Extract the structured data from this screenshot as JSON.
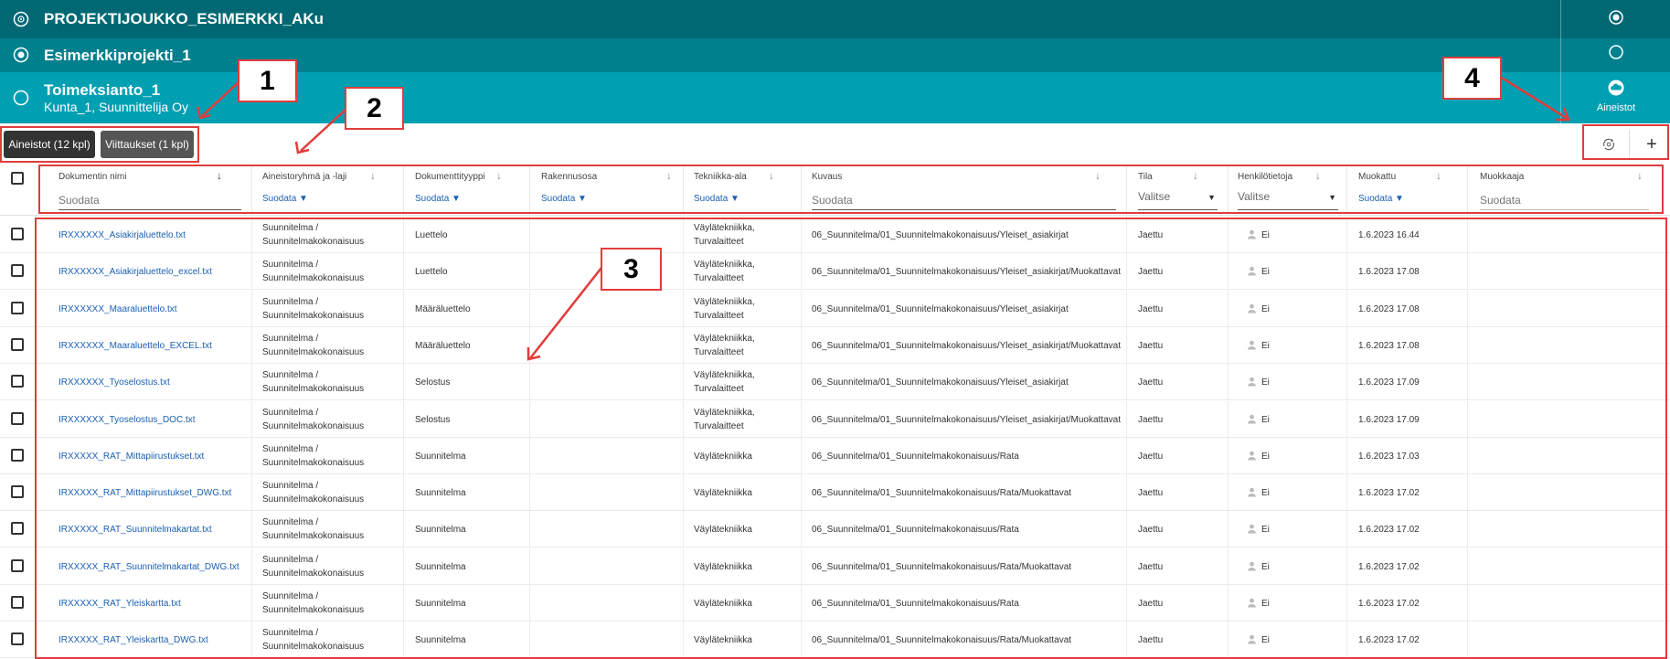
{
  "header": {
    "group_title": "PROJEKTIJOUKKO_ESIMERKKI_AKu",
    "project_title": "Esimerkkiprojekti_1",
    "assignment_title": "Toimeksianto_1",
    "assignment_subtitle": "Kunta_1, Suunnittelija Oy",
    "aineistot_label": "Aineistot"
  },
  "toolbar": {
    "tab_materials": "Aineistot (12 kpl)",
    "tab_references": "Viittaukset (1 kpl)",
    "add_label": "+"
  },
  "table": {
    "columns": [
      {
        "label": "Dokumentin nimi",
        "filter": "Suodata",
        "filter_type": "input"
      },
      {
        "label": "Aineistoryhmä ja -laji",
        "filter": "Suodata",
        "filter_type": "link"
      },
      {
        "label": "Dokumenttityyppi",
        "filter": "Suodata",
        "filter_type": "link"
      },
      {
        "label": "Rakennusosa",
        "filter": "Suodata",
        "filter_type": "link"
      },
      {
        "label": "Tekniikka-ala",
        "filter": "Suodata",
        "filter_type": "link"
      },
      {
        "label": "Kuvaus",
        "filter": "Suodata",
        "filter_type": "input"
      },
      {
        "label": "Tila",
        "filter": "Valitse",
        "filter_type": "select"
      },
      {
        "label": "Henkilötietoja",
        "filter": "Valitse",
        "filter_type": "select"
      },
      {
        "label": "Muokattu",
        "filter": "Suodata",
        "filter_type": "link"
      },
      {
        "label": "Muokkaaja",
        "filter": "Suodata",
        "filter_type": "input"
      }
    ],
    "rows": [
      {
        "name": "IRXXXXXX_Asiakirjaluettelo.txt",
        "group1": "Suunnitelma /",
        "group2": "Suunnitelmakokonaisuus",
        "type": "Luettelo",
        "tech1": "Väylätekniikka,",
        "tech2": "Turvalaitteet",
        "desc": "06_Suunnitelma/01_Suunnitelmakokonaisuus/Yleiset_asiakirjat",
        "status": "Jaettu",
        "personal": "Ei",
        "modified": "1.6.2023 16.44"
      },
      {
        "name": "IRXXXXXX_Asiakirjaluettelo_excel.txt",
        "group1": "Suunnitelma /",
        "group2": "Suunnitelmakokonaisuus",
        "type": "Luettelo",
        "tech1": "Väylätekniikka,",
        "tech2": "Turvalaitteet",
        "desc": "06_Suunnitelma/01_Suunnitelmakokonaisuus/Yleiset_asiakirjat/Muokattavat",
        "status": "Jaettu",
        "personal": "Ei",
        "modified": "1.6.2023 17.08"
      },
      {
        "name": "IRXXXXXX_Maaraluettelo.txt",
        "group1": "Suunnitelma /",
        "group2": "Suunnitelmakokonaisuus",
        "type": "Määräluettelo",
        "tech1": "Väylätekniikka,",
        "tech2": "Turvalaitteet",
        "desc": "06_Suunnitelma/01_Suunnitelmakokonaisuus/Yleiset_asiakirjat",
        "status": "Jaettu",
        "personal": "Ei",
        "modified": "1.6.2023 17.08"
      },
      {
        "name": "IRXXXXXX_Maaraluettelo_EXCEL.txt",
        "group1": "Suunnitelma /",
        "group2": "Suunnitelmakokonaisuus",
        "type": "Määräluettelo",
        "tech1": "Väylätekniikka,",
        "tech2": "Turvalaitteet",
        "desc": "06_Suunnitelma/01_Suunnitelmakokonaisuus/Yleiset_asiakirjat/Muokattavat",
        "status": "Jaettu",
        "personal": "Ei",
        "modified": "1.6.2023 17.08"
      },
      {
        "name": "IRXXXXXX_Tyoselostus.txt",
        "group1": "Suunnitelma /",
        "group2": "Suunnitelmakokonaisuus",
        "type": "Selostus",
        "tech1": "Väylätekniikka,",
        "tech2": "Turvalaitteet",
        "desc": "06_Suunnitelma/01_Suunnitelmakokonaisuus/Yleiset_asiakirjat",
        "status": "Jaettu",
        "personal": "Ei",
        "modified": "1.6.2023 17.09"
      },
      {
        "name": "IRXXXXXX_Tyoselostus_DOC.txt",
        "group1": "Suunnitelma /",
        "group2": "Suunnitelmakokonaisuus",
        "type": "Selostus",
        "tech1": "Väylätekniikka,",
        "tech2": "Turvalaitteet",
        "desc": "06_Suunnitelma/01_Suunnitelmakokonaisuus/Yleiset_asiakirjat/Muokattavat",
        "status": "Jaettu",
        "personal": "Ei",
        "modified": "1.6.2023 17.09"
      },
      {
        "name": "IRXXXXX_RAT_Mittapiirustukset.txt",
        "group1": "Suunnitelma /",
        "group2": "Suunnitelmakokonaisuus",
        "type": "Suunnitelma",
        "tech1": "Väylätekniikka",
        "tech2": "",
        "desc": "06_Suunnitelma/01_Suunnitelmakokonaisuus/Rata",
        "status": "Jaettu",
        "personal": "Ei",
        "modified": "1.6.2023 17.03"
      },
      {
        "name": "IRXXXXX_RAT_Mittapiirustukset_DWG.txt",
        "group1": "Suunnitelma /",
        "group2": "Suunnitelmakokonaisuus",
        "type": "Suunnitelma",
        "tech1": "Väylätekniikka",
        "tech2": "",
        "desc": "06_Suunnitelma/01_Suunnitelmakokonaisuus/Rata/Muokattavat",
        "status": "Jaettu",
        "personal": "Ei",
        "modified": "1.6.2023 17.02"
      },
      {
        "name": "IRXXXXX_RAT_Suunnitelmakartat.txt",
        "group1": "Suunnitelma /",
        "group2": "Suunnitelmakokonaisuus",
        "type": "Suunnitelma",
        "tech1": "Väylätekniikka",
        "tech2": "",
        "desc": "06_Suunnitelma/01_Suunnitelmakokonaisuus/Rata",
        "status": "Jaettu",
        "personal": "Ei",
        "modified": "1.6.2023 17.02"
      },
      {
        "name": "IRXXXXX_RAT_Suunnitelmakartat_DWG.txt",
        "group1": "Suunnitelma /",
        "group2": "Suunnitelmakokonaisuus",
        "type": "Suunnitelma",
        "tech1": "Väylätekniikka",
        "tech2": "",
        "desc": "06_Suunnitelma/01_Suunnitelmakokonaisuus/Rata/Muokattavat",
        "status": "Jaettu",
        "personal": "Ei",
        "modified": "1.6.2023 17.02"
      },
      {
        "name": "IRXXXXX_RAT_Yleiskartta.txt",
        "group1": "Suunnitelma /",
        "group2": "Suunnitelmakokonaisuus",
        "type": "Suunnitelma",
        "tech1": "Väylätekniikka",
        "tech2": "",
        "desc": "06_Suunnitelma/01_Suunnitelmakokonaisuus/Rata",
        "status": "Jaettu",
        "personal": "Ei",
        "modified": "1.6.2023 17.02"
      },
      {
        "name": "IRXXXXX_RAT_Yleiskartta_DWG.txt",
        "group1": "Suunnitelma /",
        "group2": "Suunnitelmakokonaisuus",
        "type": "Suunnitelma",
        "tech1": "Väylätekniikka",
        "tech2": "",
        "desc": "06_Suunnitelma/01_Suunnitelmakokonaisuus/Rata/Muokattavat",
        "status": "Jaettu",
        "personal": "Ei",
        "modified": "1.6.2023 17.02"
      }
    ]
  },
  "annotations": {
    "n1": "1",
    "n2": "2",
    "n3": "3",
    "n4": "4",
    "color": "#e23c3c"
  },
  "colors": {
    "header_dark": "#006873",
    "header_mid": "#007f8d",
    "header_light": "#00a0b2",
    "link": "#1a5fb4"
  }
}
